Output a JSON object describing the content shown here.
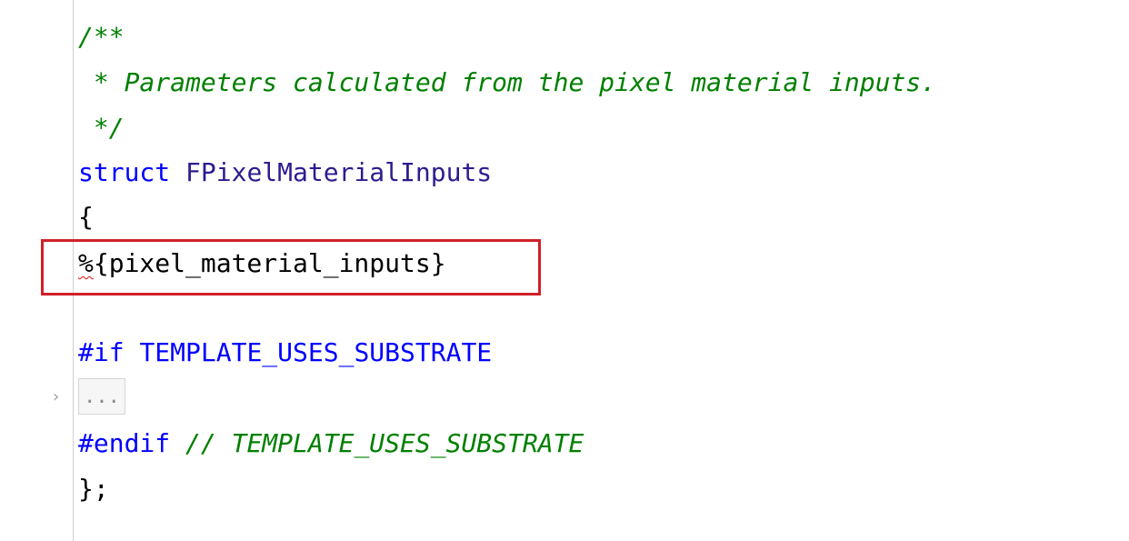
{
  "code": {
    "comment_open": "/**",
    "comment_body": " * Parameters calculated from the pixel material inputs.",
    "comment_close": " */",
    "struct_keyword": "struct",
    "struct_name": "FPixelMaterialInputs",
    "open_brace": "{",
    "template_percent": "%",
    "template_var": "{pixel_material_inputs}",
    "if_directive": "#if",
    "if_condition": "TEMPLATE_USES_SUBSTRATE",
    "folded_placeholder": "...",
    "endif_directive": "#endif",
    "endif_comment": "// TEMPLATE_USES_SUBSTRATE",
    "close_brace": "};"
  },
  "icons": {
    "fold": "chevron-right-icon"
  },
  "colors": {
    "comment": "#008000",
    "keyword": "#0000ff",
    "type": "#2e1b8f",
    "highlight_box": "#d0202a",
    "squiggle": "#e01010"
  }
}
